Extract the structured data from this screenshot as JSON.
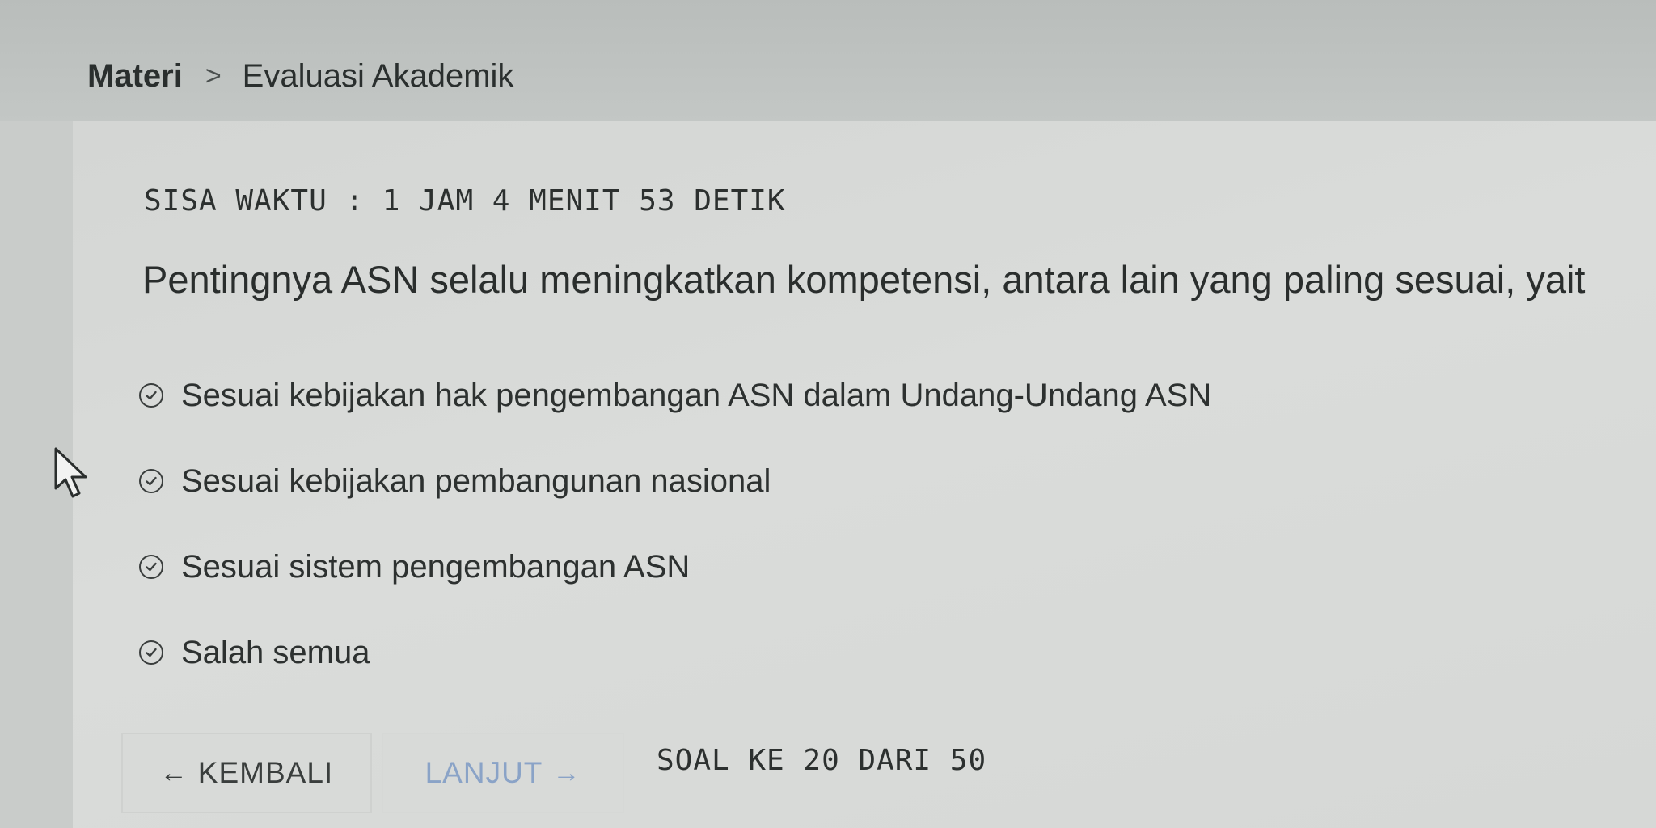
{
  "breadcrumb": {
    "root": "Materi",
    "separator": ">",
    "current": "Evaluasi Akademik"
  },
  "exam": {
    "timer": "SISA WAKTU : 1 JAM 4 MENIT 53 DETIK",
    "question": "Pentingnya ASN selalu meningkatkan kompetensi, antara lain yang paling sesuai, yait",
    "options": [
      {
        "label": "Sesuai kebijakan hak pengembangan ASN dalam Undang-Undang ASN",
        "icon": "check-circle-icon"
      },
      {
        "label": "Sesuai kebijakan pembangunan nasional",
        "icon": "check-circle-icon"
      },
      {
        "label": "Sesuai sistem pengembangan ASN",
        "icon": "check-circle-icon"
      },
      {
        "label": "Salah semua",
        "icon": "check-circle-icon"
      }
    ]
  },
  "navigation": {
    "back_arrow": "←",
    "back_label": "KEMBALI",
    "next_label": "LANJUT",
    "next_arrow": "→",
    "counter": "SOAL KE 20 DARI 50"
  },
  "colors": {
    "background": "#c9ccca",
    "card": "#d8dad8",
    "text": "#2b2f2e",
    "next_accent": "#8aa3c7"
  }
}
